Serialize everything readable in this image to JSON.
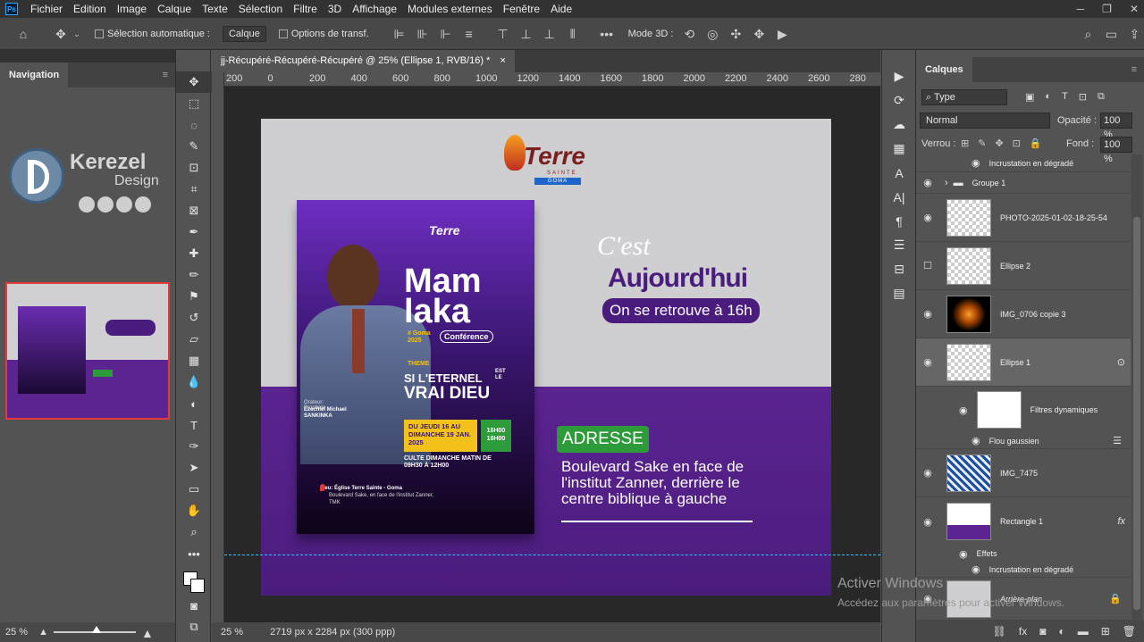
{
  "menubar": {
    "items": [
      "Fichier",
      "Edition",
      "Image",
      "Calque",
      "Texte",
      "Sélection",
      "Filtre",
      "3D",
      "Affichage",
      "Modules externes",
      "Fenêtre",
      "Aide"
    ]
  },
  "options": {
    "auto_select_label": "Sélection automatique :",
    "auto_select_value": "Calque",
    "transform_label": "Options de transf.",
    "mode3d_label": "Mode 3D :"
  },
  "navigation": {
    "title": "Navigation",
    "zoom": "25 %"
  },
  "document": {
    "tab_title": "jj-Récupéré-Récupéré-Récupéré @ 25% (Ellipse 1, RVB/16) *",
    "ruler_labels": [
      "200",
      "0",
      "200",
      "400",
      "600",
      "800",
      "1000",
      "1200",
      "1400",
      "1600",
      "1800",
      "2000",
      "2200",
      "2400",
      "2600",
      "280"
    ],
    "status_zoom": "25 %",
    "status_size": "2719 px x 2284 px (300 ppp)"
  },
  "artwork": {
    "brand_top": "Terre",
    "brand_sub": "SAINTE",
    "brand_city": "GOMA",
    "cest": "C'est",
    "aujourdhui": "Aujourd'hui",
    "rendezvous": "On se retrouve à 16h",
    "adresse_label": "ADRESSE",
    "adresse_text": [
      "Boulevard Sake en face de",
      "l'institut Zanner, derrière le",
      "centre biblique à gauche"
    ],
    "flyer": {
      "title1": "Mam",
      "title2": "laka",
      "goma": "# Goma 2025",
      "conference": "Conférence",
      "theme_label": "THEME",
      "theme1": "SI L'ETERNEL",
      "est_le": "EST LE",
      "theme2": "VRAI DIEU",
      "orateur": "Orateur: Prophète",
      "orateur_name": "Ezechiel Michael SANKINKA",
      "dates": "DU JEUDI 16 AU DIMANCHE 19 JAN. 2025",
      "hours": "16H00 18H00",
      "culte": "CULTE DIMANCHE MATIN DE 09H30 À 12H00",
      "lieu": "Lieu: Église Terre Sainte - Goma",
      "lieu_detail": "Boulevard Sake, en face de l'institut Zanner, TMK"
    },
    "watermark_brand": "Kerezel",
    "watermark_design": "Design"
  },
  "layers": {
    "title": "Calques",
    "filter_type": "Type",
    "blend_mode": "Normal",
    "opacity_label": "Opacité :",
    "opacity_value": "100 %",
    "lock_label": "Verrou :",
    "fill_label": "Fond :",
    "fill_value": "100 %",
    "items": [
      {
        "name": "Incrustation en dégradé"
      },
      {
        "name": "Groupe 1"
      },
      {
        "name": "PHOTO-2025-01-02-18-25-54"
      },
      {
        "name": "Ellipse 2"
      },
      {
        "name": "IMG_0706 copie 3"
      },
      {
        "name": "Ellipse 1"
      },
      {
        "name": "Filtres dynamiques"
      },
      {
        "name": "Flou gaussien"
      },
      {
        "name": "IMG_7475"
      },
      {
        "name": "Rectangle 1"
      },
      {
        "name": "Effets"
      },
      {
        "name": "Incrustation en dégradé"
      },
      {
        "name": "Arrière-plan"
      }
    ]
  },
  "windows_notice": {
    "line1": "Activer Windows",
    "line2": "Accédez aux paramètres pour activer Windows."
  },
  "colors": {
    "accent_purple": "#5b2491",
    "address_green": "#2e9b3a",
    "flyer_yellow": "#f2c21b"
  }
}
